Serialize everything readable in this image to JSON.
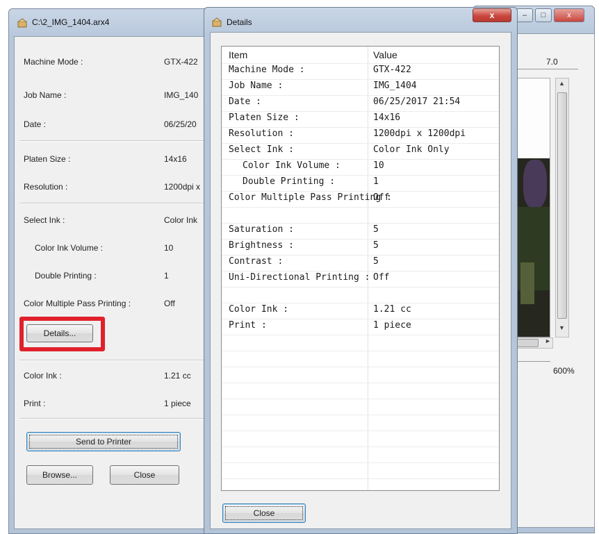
{
  "main_window": {
    "title": "C:\\2_IMG_1404.arx4",
    "fields": [
      {
        "label": "Machine Mode :",
        "value": "GTX-422"
      },
      {
        "label": "Job Name :",
        "value": "IMG_140"
      },
      {
        "label": "Date :",
        "value": "06/25/20"
      },
      {
        "label": "Platen Size :",
        "value": "14x16"
      },
      {
        "label": "Resolution :",
        "value": "1200dpi x"
      },
      {
        "label": "Select Ink :",
        "value": "Color Ink"
      },
      {
        "label": "Color Ink Volume :",
        "value": "10"
      },
      {
        "label": "Double Printing :",
        "value": "1"
      },
      {
        "label": "Color Multiple Pass Printing :",
        "value": "Off"
      },
      {
        "label": "Color Ink :",
        "value": "1.21 cc"
      },
      {
        "label": "Print :",
        "value": "1 piece"
      }
    ],
    "details_button": "Details...",
    "send_button": "Send to Printer",
    "browse_button": "Browse...",
    "close_button": "Close"
  },
  "preview_window": {
    "ruler_value": "7.0",
    "zoom_value": "600%"
  },
  "details_dialog": {
    "title": "Details",
    "close_x": "x",
    "header": {
      "item": "Item",
      "value": "Value"
    },
    "rows": [
      {
        "item": "Machine Mode :",
        "value": "GTX-422"
      },
      {
        "item": "Job Name :",
        "value": "IMG_1404"
      },
      {
        "item": "Date :",
        "value": "06/25/2017 21:54"
      },
      {
        "item": "Platen Size :",
        "value": "14x16"
      },
      {
        "item": "Resolution :",
        "value": "1200dpi x 1200dpi"
      },
      {
        "item": "Select Ink :",
        "value": "Color Ink Only"
      },
      {
        "item": "Color Ink Volume :",
        "value": "10"
      },
      {
        "item": "Double Printing :",
        "value": "1"
      },
      {
        "item": "Color Multiple Pass Printing :",
        "value": "Off"
      },
      {
        "item": "",
        "value": ""
      },
      {
        "item": "Saturation :",
        "value": "5"
      },
      {
        "item": "Brightness :",
        "value": "5"
      },
      {
        "item": "Contrast :",
        "value": "5"
      },
      {
        "item": "Uni-Directional Printing :",
        "value": "Off"
      },
      {
        "item": "",
        "value": ""
      },
      {
        "item": "Color Ink :",
        "value": "1.21 cc"
      },
      {
        "item": "Print :",
        "value": "1 piece"
      },
      {
        "item": "",
        "value": ""
      },
      {
        "item": "",
        "value": ""
      },
      {
        "item": "",
        "value": ""
      },
      {
        "item": "",
        "value": ""
      },
      {
        "item": "",
        "value": ""
      },
      {
        "item": "",
        "value": ""
      },
      {
        "item": "",
        "value": ""
      },
      {
        "item": "",
        "value": ""
      },
      {
        "item": "",
        "value": ""
      }
    ],
    "close_button": "Close"
  },
  "colors": {
    "highlight_box": "#e0212c",
    "close_red": "#c9463d",
    "window_frame": "#b8c8dc"
  }
}
